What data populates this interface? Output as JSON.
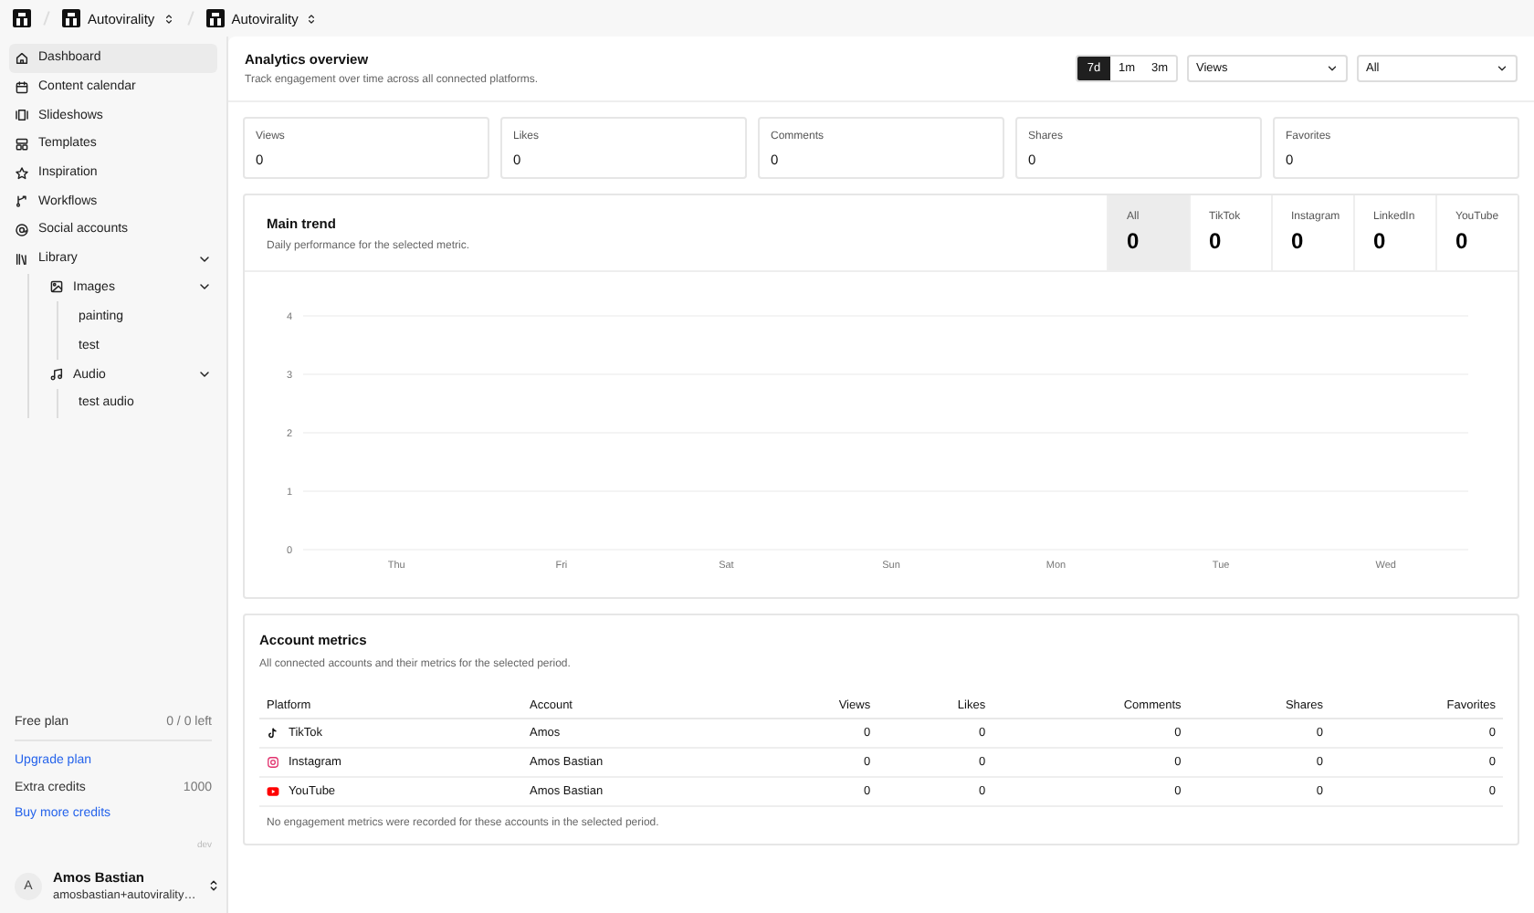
{
  "breadcrumb": [
    {
      "label": "Autovirality"
    },
    {
      "label": "Autovirality"
    }
  ],
  "sidebar": {
    "items": [
      {
        "label": "Dashboard",
        "kind": "home",
        "selected": true
      },
      {
        "label": "Content calendar",
        "kind": "calendar",
        "selected": false
      },
      {
        "label": "Slideshows",
        "kind": "slides",
        "selected": false
      },
      {
        "label": "Templates",
        "kind": "templates",
        "selected": false
      },
      {
        "label": "Inspiration",
        "kind": "star",
        "selected": false
      },
      {
        "label": "Workflows",
        "kind": "workflow",
        "selected": false
      },
      {
        "label": "Social accounts",
        "kind": "at",
        "selected": false
      },
      {
        "label": "Library",
        "kind": "library",
        "selected": false,
        "expanded": true,
        "children": [
          {
            "label": "Images",
            "kind": "image",
            "expanded": true,
            "children": [
              {
                "label": "painting"
              },
              {
                "label": "test"
              }
            ]
          },
          {
            "label": "Audio",
            "kind": "music",
            "expanded": true,
            "children": [
              {
                "label": "test audio"
              }
            ]
          }
        ]
      }
    ]
  },
  "plan": {
    "name": "Free plan",
    "usage": "0 / 0 left",
    "upgrade_link": "Upgrade plan",
    "credits_label": "Extra credits",
    "credits_value": "1000",
    "buy_link": "Buy more credits",
    "env": "dev"
  },
  "user": {
    "avatar": "A",
    "name": "Amos Bastian",
    "email": "amosbastian+autovirality…"
  },
  "overview": {
    "title": "Analytics overview",
    "subtitle": "Track engagement over time across all connected platforms.",
    "ranges": [
      {
        "label": "7d",
        "selected": true
      },
      {
        "label": "1m",
        "selected": false
      },
      {
        "label": "3m",
        "selected": false
      }
    ],
    "metric_select": "Views",
    "platform_select": "All"
  },
  "stats": [
    {
      "label": "Views",
      "value": "0"
    },
    {
      "label": "Likes",
      "value": "0"
    },
    {
      "label": "Comments",
      "value": "0"
    },
    {
      "label": "Shares",
      "value": "0"
    },
    {
      "label": "Favorites",
      "value": "0"
    }
  ],
  "trend": {
    "title": "Main trend",
    "subtitle": "Daily performance for the selected metric.",
    "tabs": [
      {
        "label": "All",
        "value": "0",
        "selected": true
      },
      {
        "label": "TikTok",
        "value": "0",
        "selected": false
      },
      {
        "label": "Instagram",
        "value": "0",
        "selected": false
      },
      {
        "label": "LinkedIn",
        "value": "0",
        "selected": false
      },
      {
        "label": "YouTube",
        "value": "0",
        "selected": false
      }
    ],
    "chart_data": {
      "type": "line",
      "categories": [
        "Thu",
        "Fri",
        "Sat",
        "Sun",
        "Mon",
        "Tue",
        "Wed"
      ],
      "ylim": [
        0,
        4
      ],
      "yticks": [
        0,
        1,
        2,
        3,
        4
      ],
      "grid": true
    }
  },
  "accounts": {
    "title": "Account metrics",
    "subtitle": "All connected accounts and their metrics for the selected period.",
    "columns": [
      "Platform",
      "Account",
      "Views",
      "Likes",
      "Comments",
      "Shares",
      "Favorites"
    ],
    "rows": [
      {
        "kind": "tiktok",
        "platform": "TikTok",
        "account": "Amos",
        "views": "0",
        "likes": "0",
        "comments": "0",
        "shares": "0",
        "favorites": "0"
      },
      {
        "kind": "instagram",
        "platform": "Instagram",
        "account": "Amos Bastian",
        "views": "0",
        "likes": "0",
        "comments": "0",
        "shares": "0",
        "favorites": "0"
      },
      {
        "kind": "youtube",
        "platform": "YouTube",
        "account": "Amos Bastian",
        "views": "0",
        "likes": "0",
        "comments": "0",
        "shares": "0",
        "favorites": "0"
      }
    ],
    "note": "No engagement metrics were recorded for these accounts in the selected period."
  }
}
